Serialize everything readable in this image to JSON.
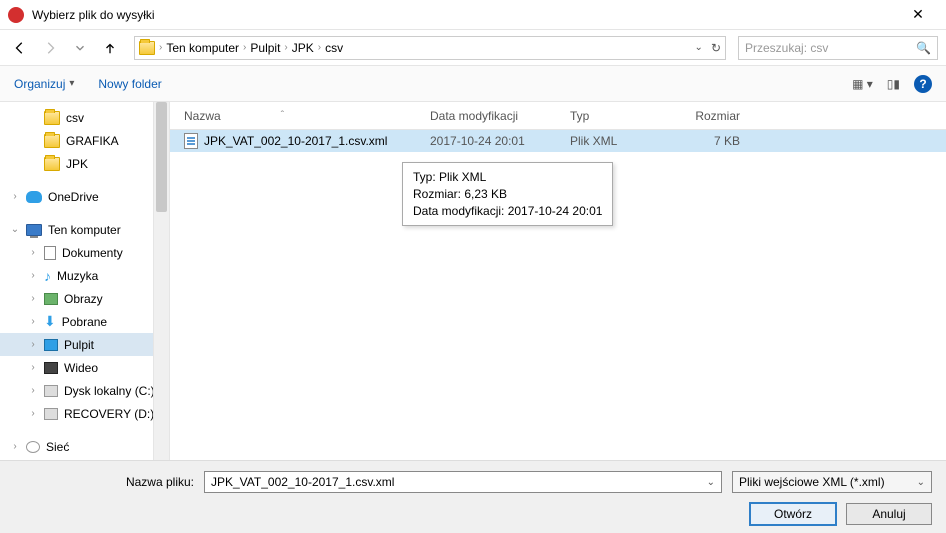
{
  "titlebar": {
    "title": "Wybierz plik do wysyłki"
  },
  "breadcrumb": {
    "root": "Ten komputer",
    "parts": [
      "Pulpit",
      "JPK",
      "csv"
    ]
  },
  "search": {
    "placeholder": "Przeszukaj: csv"
  },
  "toolbar": {
    "organize": "Organizuj",
    "newfolder": "Nowy folder"
  },
  "tree": {
    "csv": "csv",
    "grafika": "GRAFIKA",
    "jpk": "JPK",
    "onedrive": "OneDrive",
    "tenkomputer": "Ten komputer",
    "dokumenty": "Dokumenty",
    "muzyka": "Muzyka",
    "obrazy": "Obrazy",
    "pobrane": "Pobrane",
    "pulpit": "Pulpit",
    "wideo": "Wideo",
    "dysklok": "Dysk lokalny (C:)",
    "recovery": "RECOVERY (D:)",
    "siec": "Sieć"
  },
  "columns": {
    "name": "Nazwa",
    "date": "Data modyfikacji",
    "type": "Typ",
    "size": "Rozmiar"
  },
  "file": {
    "name": "JPK_VAT_002_10-2017_1.csv.xml",
    "date": "2017-10-24 20:01",
    "type": "Plik XML",
    "size": "7 KB"
  },
  "tooltip": {
    "l1": "Typ: Plik XML",
    "l2": "Rozmiar: 6,23 KB",
    "l3": "Data modyfikacji: 2017-10-24 20:01"
  },
  "footer": {
    "fn_label": "Nazwa pliku:",
    "fn_value": "JPK_VAT_002_10-2017_1.csv.xml",
    "filter": "Pliki wejściowe XML (*.xml)",
    "open": "Otwórz",
    "cancel": "Anuluj"
  }
}
